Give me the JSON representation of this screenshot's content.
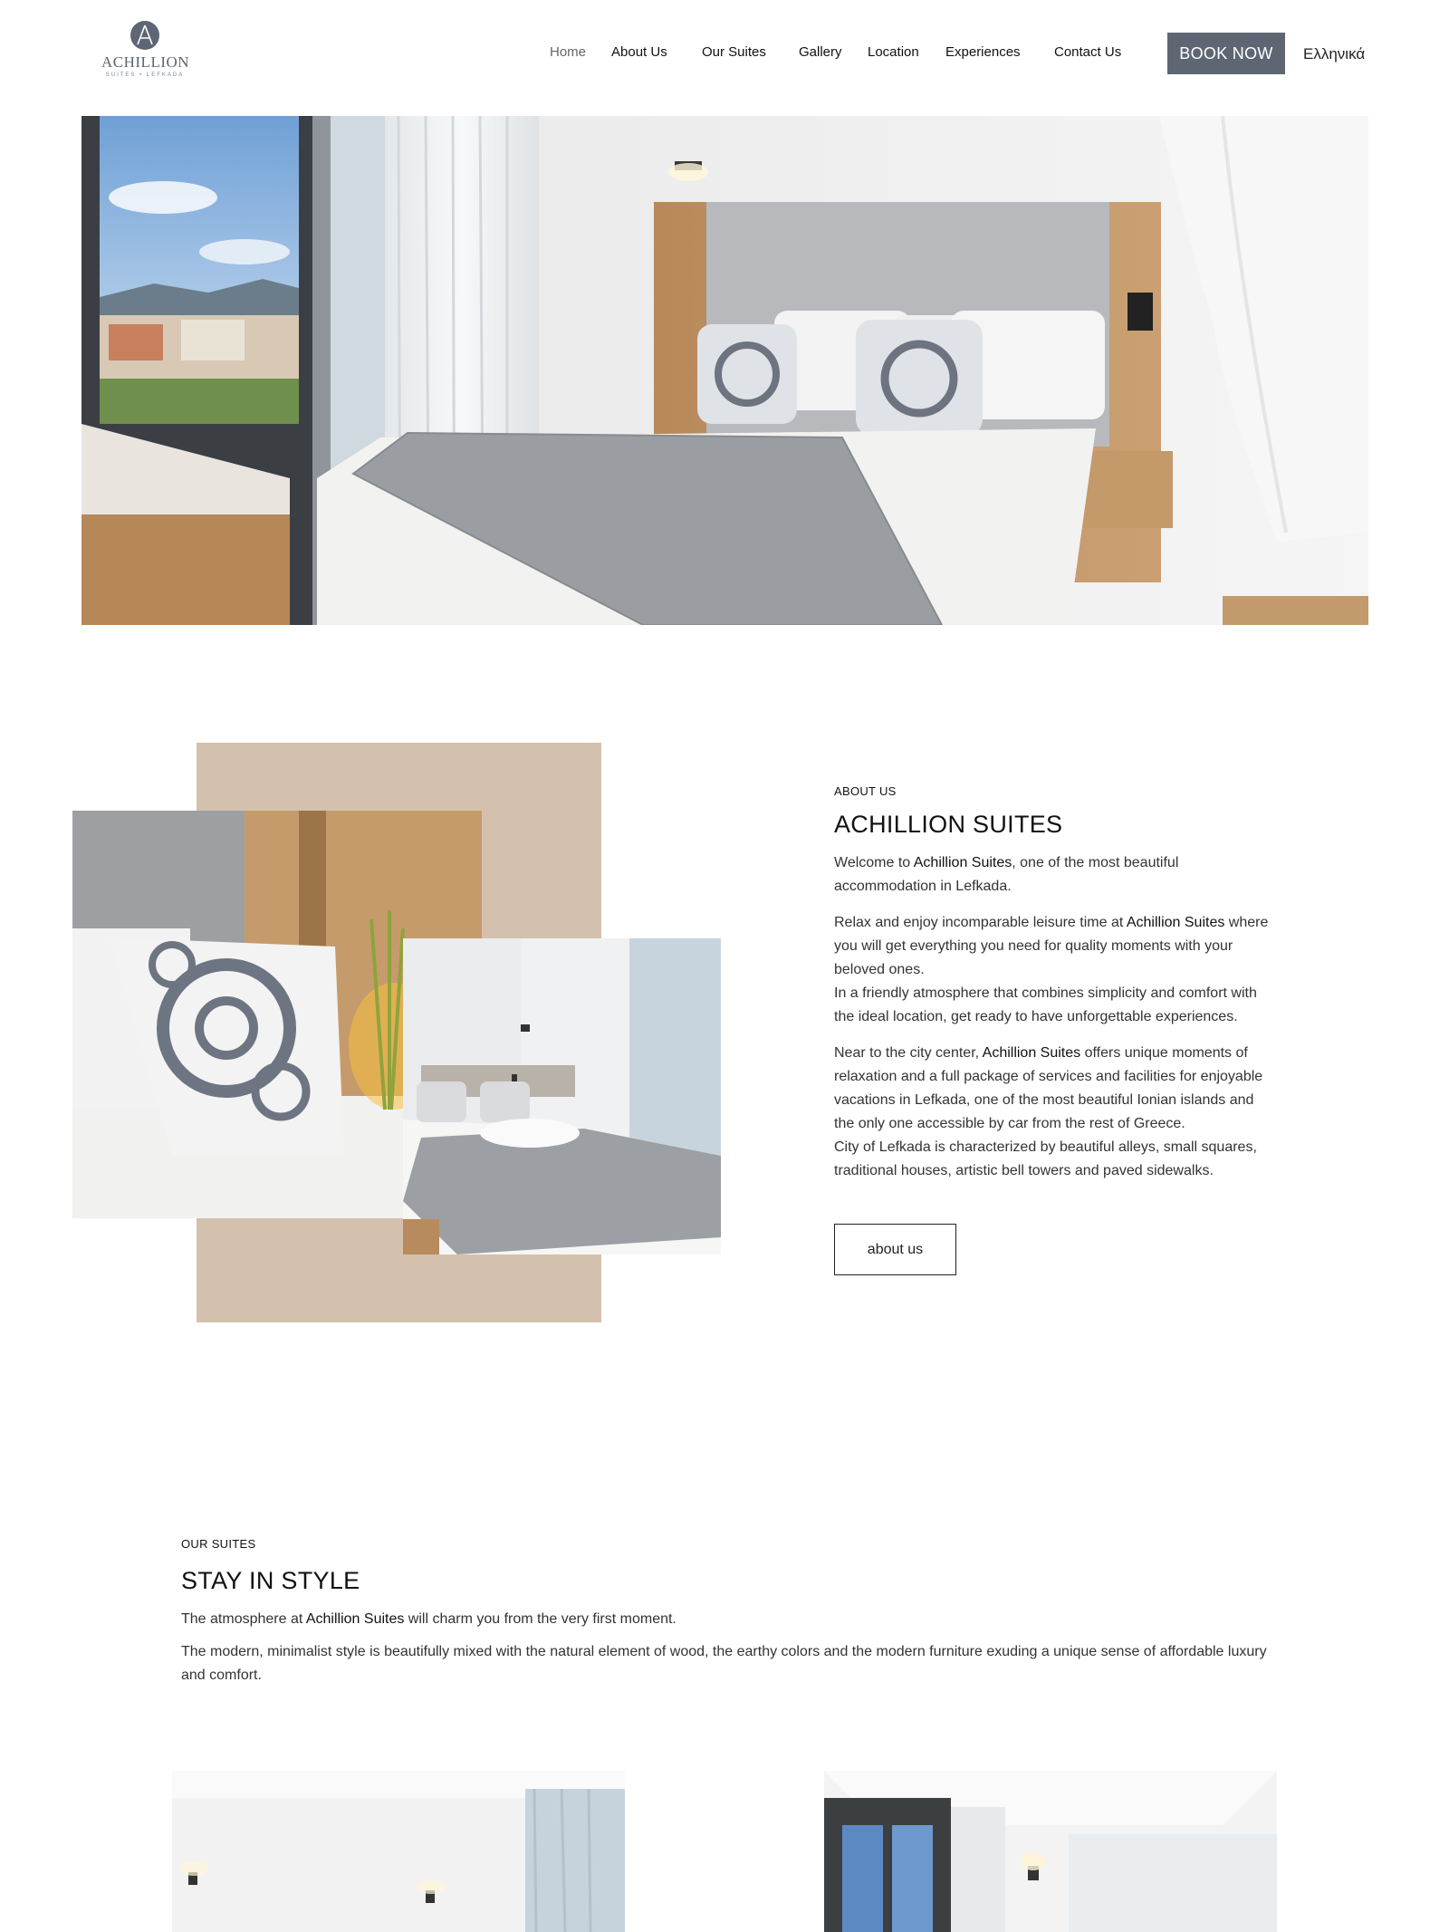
{
  "brand": {
    "name": "ACHILLION",
    "subtitle": "SUITES • LEFKADA",
    "logo_icon": "achillion-logo-icon",
    "accent_color": "#5f6673",
    "beige_color": "#d4c1ad"
  },
  "nav": {
    "items": [
      {
        "label": "Home",
        "active": true
      },
      {
        "label": "About Us"
      },
      {
        "label": "Our Suites"
      },
      {
        "label": "Gallery"
      },
      {
        "label": "Location"
      },
      {
        "label": "Experiences"
      },
      {
        "label": "Contact Us"
      }
    ],
    "book_label": "BOOK NOW",
    "language_label": "Ελληνικά"
  },
  "about": {
    "eyebrow": "ABOUT US",
    "title": "ACHILLION SUITES",
    "p1_pre": "Welcome to ",
    "p1_bold": "Achillion Suites",
    "p1_post": ", one of the most beautiful accommodation in Lefkada.",
    "p2_pre": "Relax and enjoy incomparable leisure time at ",
    "p2_bold": "Achillion Suites",
    "p2_post": " where you will get everything you need for quality moments with your beloved ones.",
    "p2_line2": "In a friendly atmosphere that combines simplicity and comfort with the ideal location, get ready to have unforgettable experiences.",
    "p3_pre": "Near to the city center, ",
    "p3_bold": "Achillion Suites",
    "p3_post": " offers unique moments of relaxation and a full package of services and facilities for enjoyable vacations in Lefkada, one of the most beautiful Ionian islands and the only one accessible by car from the rest of Greece.",
    "p3_line2": "City of Lefkada is characterized by beautiful alleys, small squares, traditional houses, artistic bell towers and paved sidewalks.",
    "button_label": "about us"
  },
  "suites": {
    "eyebrow": "OUR SUITES",
    "title": "STAY IN STYLE",
    "p1_pre": "The atmosphere at ",
    "p1_bold": "Achillion Suites",
    "p1_post": " will charm you from the very first moment.",
    "p2": "The modern, minimalist style is beautifully mixed with the natural element of wood, the earthy colors and the modern furniture exuding a unique sense of affordable luxury and comfort."
  }
}
